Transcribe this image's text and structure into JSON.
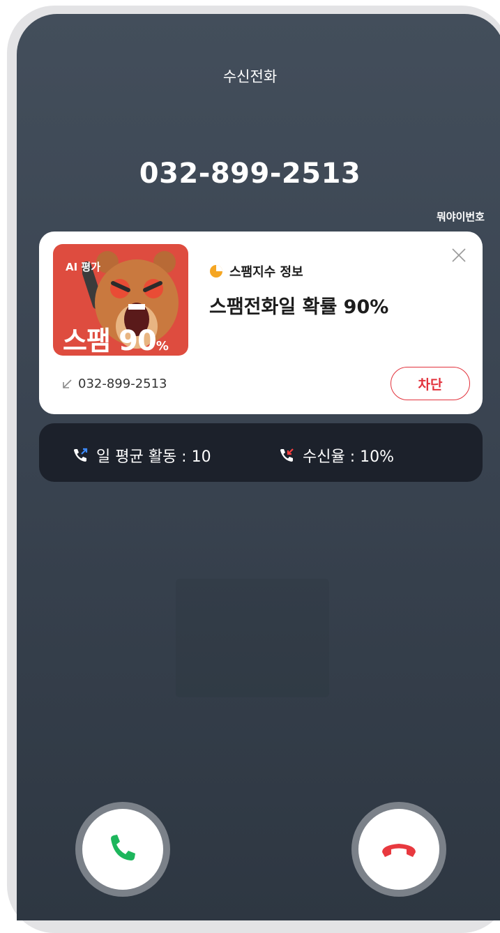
{
  "header": {
    "title": "수신전화"
  },
  "caller": {
    "number": "032-899-2513",
    "provider": "뭐야이번호"
  },
  "spam_card": {
    "thumb_tag": "AI 평가",
    "thumb_label": "스팸",
    "thumb_value": "90",
    "thumb_unit": "%",
    "info_label": "스팸지수 정보",
    "headline": "스팸전화일 확률 90%",
    "incoming_number": "032-899-2513",
    "block_label": "차단"
  },
  "stats": {
    "daily_activity": "일 평균 활동 : 10",
    "answer_rate": "수신율 : 10%"
  },
  "icons": [
    "pie-chart-icon",
    "close-icon",
    "incoming-arrow-icon",
    "outgoing-call-icon",
    "incoming-call-icon",
    "accept-call-icon",
    "decline-call-icon"
  ],
  "colors": {
    "accept": "#1db65c",
    "decline": "#e8393f",
    "block": "#e2323c",
    "pie": "#f5a623"
  }
}
